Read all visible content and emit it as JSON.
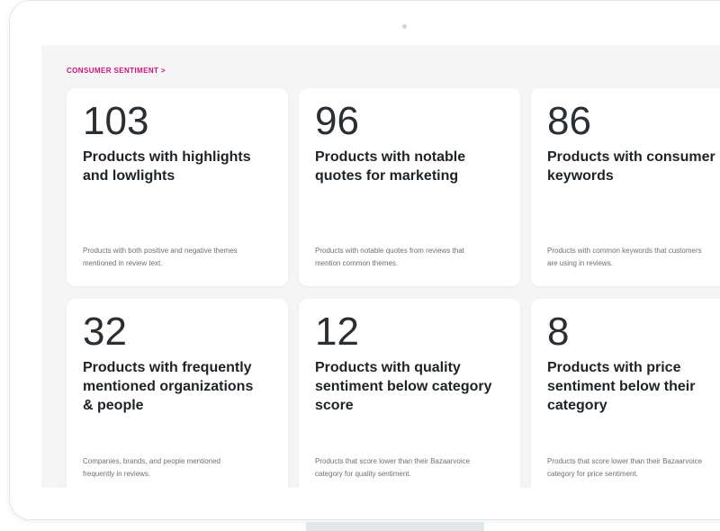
{
  "section": {
    "title": "CONSUMER SENTIMENT >"
  },
  "cards": [
    {
      "number": "103",
      "title": "Products with highlights\nand lowlights",
      "description": "Products with both positive and negative themes\nmentioned in review text."
    },
    {
      "number": "96",
      "title": "Products with notable\nquotes for marketing",
      "description": "Products with notable quotes from reviews that\nmention common themes."
    },
    {
      "number": "86",
      "title": "Products with consumer\nkeywords",
      "description": "Products with common keywords that customers\nare using in reviews."
    },
    {
      "number": "32",
      "title": "Products with frequently\nmentioned organizations\n& people",
      "description": "Companies, brands, and people mentioned\nfrequently in reviews."
    },
    {
      "number": "12",
      "title": "Products with quality\nsentiment below category\nscore",
      "description": "Products that score lower than their Bazaarvoice\ncategory for quality sentiment."
    },
    {
      "number": "8",
      "title": "Products with price\nsentiment below their\ncategory",
      "description": "Products that score lower than their Bazaarvoice\ncategory for price sentiment."
    }
  ],
  "colors": {
    "accent": "#d3127e",
    "card_background": "#ffffff",
    "screen_background": "#f5f5f6"
  }
}
